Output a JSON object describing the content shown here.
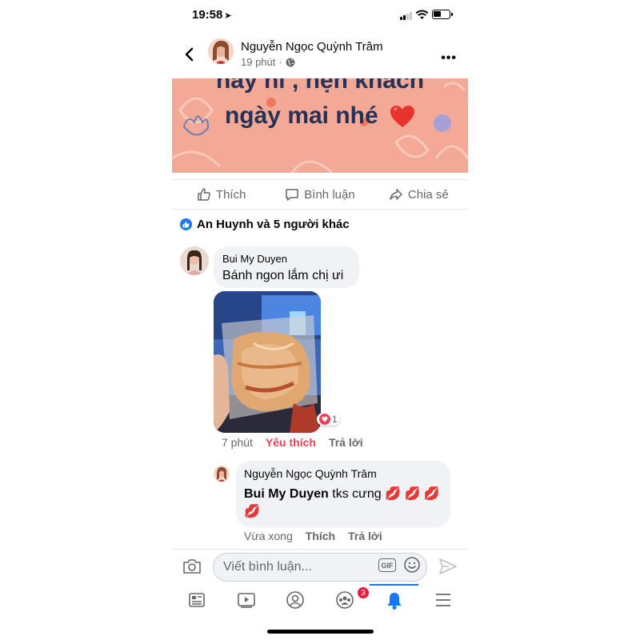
{
  "status_bar": {
    "time": "19:58"
  },
  "post": {
    "author": "Nguyễn Ngọc Quỳnh Trâm",
    "time": "19 phút",
    "banner_line1": "nay hi , hẹn khách",
    "banner_line2": "ngày mai nhé"
  },
  "actions": {
    "like": "Thích",
    "comment": "Bình luận",
    "share": "Chia sẻ"
  },
  "reactions_summary": "An Huynh và 5 người khác",
  "comments": [
    {
      "author": "Bui My Duyen",
      "text": "Bánh ngon lắm chị ưi",
      "reaction_count": "1",
      "time": "7 phút",
      "reaction_label": "Yêu thích",
      "reply_label": "Trả lời"
    },
    {
      "author": "Nguyễn Ngọc Quỳnh Trâm",
      "mention": "Bui My Duyen",
      "text": "tks cưng 💋 💋 💋 💋",
      "time": "Vừa xong",
      "like_label": "Thích",
      "reply_label": "Trả lời"
    }
  ],
  "comment_input": {
    "placeholder": "Viết bình luận...",
    "gif_label": "GIF"
  },
  "tab_bar": {
    "groups_badge": "3"
  },
  "colors": {
    "accent": "#1877f2",
    "love": "#f33e58",
    "banner_bg": "#f3a996",
    "banner_text": "#263158"
  },
  "icons": [
    "location-arrow-icon",
    "signal-icon",
    "wifi-icon",
    "battery-icon",
    "back-icon",
    "globe-icon",
    "more-icon",
    "like-icon",
    "comment-icon",
    "share-icon",
    "heart-icon",
    "camera-icon",
    "gif-icon",
    "emoji-icon",
    "send-icon",
    "news-feed-icon",
    "watch-icon",
    "profile-icon",
    "groups-icon",
    "notifications-icon",
    "menu-icon"
  ]
}
